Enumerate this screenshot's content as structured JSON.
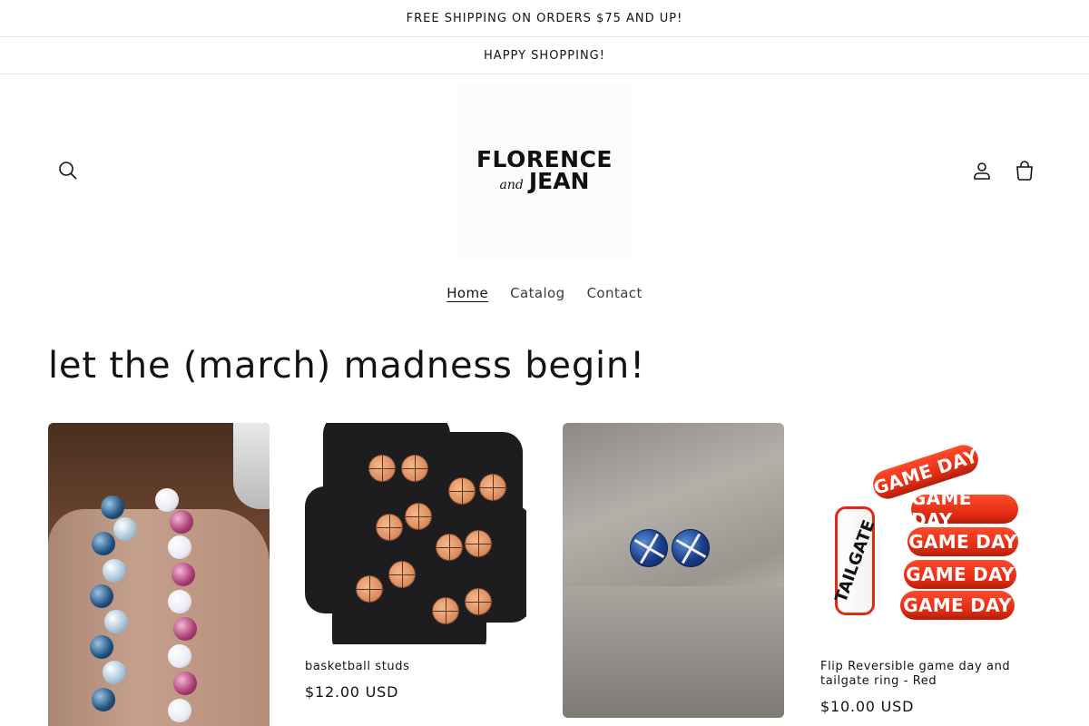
{
  "announcements": [
    "FREE SHIPPING ON ORDERS $75 AND UP!",
    "HAPPY SHOPPING!"
  ],
  "logo": {
    "line1": "FLORENCE",
    "and": "and",
    "line2": "JEAN"
  },
  "header_icons": [
    "search-icon",
    "account-icon",
    "cart-icon"
  ],
  "nav": [
    {
      "label": "Home",
      "active": true
    },
    {
      "label": "Catalog",
      "active": false
    },
    {
      "label": "Contact",
      "active": false
    }
  ],
  "collection": {
    "title": "let the (march) madness begin!",
    "products": [
      {
        "title": "",
        "price": ""
      },
      {
        "title": "basketball studs",
        "price": "$12.00 USD"
      },
      {
        "title": "",
        "price": ""
      },
      {
        "title": "Flip Reversible game day and tailgate ring - Red",
        "price": "$10.00 USD"
      }
    ],
    "product_4_image_text": {
      "ring": "GAME DAY",
      "side": "TAILGATE"
    }
  }
}
